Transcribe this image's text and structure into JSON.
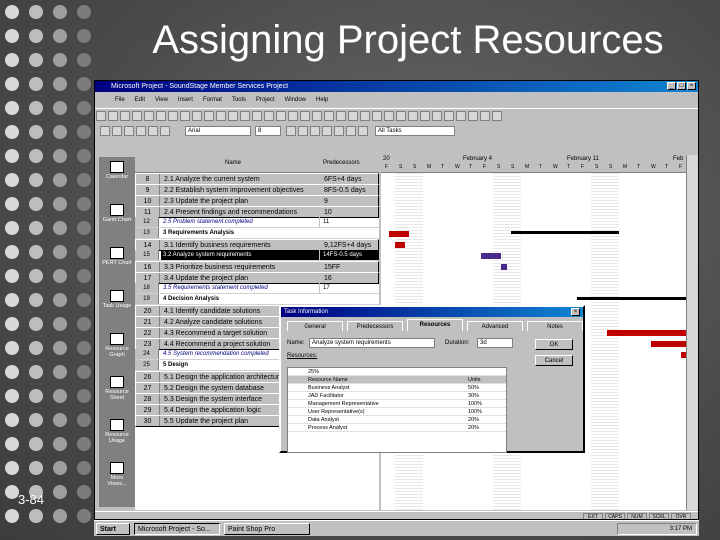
{
  "slide": {
    "title": "Assigning Project Resources",
    "page_number": "3-84"
  },
  "app": {
    "window_title": "Microsoft Project - SoundStage Member Services Project",
    "menu": [
      "File",
      "Edit",
      "View",
      "Insert",
      "Format",
      "Tools",
      "Project",
      "Window",
      "Help"
    ],
    "font_name": "Arial",
    "font_size": "8",
    "filter": "All Tasks"
  },
  "views": [
    "Calendar",
    "Gantt Chart",
    "PERT Chart",
    "Task Usage",
    "Resource Graph",
    "Resource Sheet",
    "Resource Usage",
    "More Views..."
  ],
  "table": {
    "col_name": "Name",
    "col_pred": "Predecessors",
    "rows": [
      {
        "id": "8",
        "name": "2.1 Analyze the current system",
        "pred": "6FS+4 days",
        "kind": "task"
      },
      {
        "id": "9",
        "name": "2.2 Establish system improvement objectives",
        "pred": "8FS-0.5 days",
        "kind": "task"
      },
      {
        "id": "10",
        "name": "2.3 Update the project plan",
        "pred": "9",
        "kind": "task"
      },
      {
        "id": "11",
        "name": "2.4 Present findings and recommendations",
        "pred": "10",
        "kind": "task"
      },
      {
        "id": "12",
        "name": "2.5 Problem statement completed",
        "pred": "11",
        "kind": "mile"
      },
      {
        "id": "13",
        "name": "3 Requirements Analysis",
        "pred": "",
        "kind": "sum"
      },
      {
        "id": "14",
        "name": "3.1 Identify business requirements",
        "pred": "9,12FS+4 days",
        "kind": "task"
      },
      {
        "id": "15",
        "name": "3.2 Analyze system requirements",
        "pred": "14FS-0.5 days",
        "kind": "sel"
      },
      {
        "id": "16",
        "name": "3.3 Prioritize business requirements",
        "pred": "15FF",
        "kind": "task"
      },
      {
        "id": "17",
        "name": "3.4 Update the project plan",
        "pred": "16",
        "kind": "task"
      },
      {
        "id": "18",
        "name": "3.5 Requirements statement completed",
        "pred": "17",
        "kind": "mile"
      },
      {
        "id": "19",
        "name": "4 Decision Analysis",
        "pred": "",
        "kind": "sum"
      },
      {
        "id": "20",
        "name": "4.1 Identify candidate solutions",
        "pred": "",
        "kind": "task"
      },
      {
        "id": "21",
        "name": "4.2 Analyze candidate solutions",
        "pred": "",
        "kind": "task"
      },
      {
        "id": "22",
        "name": "4.3 Recommend a target solution",
        "pred": "",
        "kind": "task"
      },
      {
        "id": "23",
        "name": "4.4 Recommend a project solution",
        "pred": "",
        "kind": "task"
      },
      {
        "id": "24",
        "name": "4.5 System recommendation completed",
        "pred": "",
        "kind": "mile"
      },
      {
        "id": "25",
        "name": "5 Design",
        "pred": "",
        "kind": "sum"
      },
      {
        "id": "26",
        "name": "5.1 Design the application architecture",
        "pred": "",
        "kind": "task"
      },
      {
        "id": "27",
        "name": "5.2 Design the system database",
        "pred": "",
        "kind": "task"
      },
      {
        "id": "28",
        "name": "5.3 Design the system interface",
        "pred": "",
        "kind": "task"
      },
      {
        "id": "29",
        "name": "5.4 Design the application logic",
        "pred": "",
        "kind": "task"
      },
      {
        "id": "30",
        "name": "5.5 Update the project plan",
        "pred": "",
        "kind": "task"
      }
    ]
  },
  "gantt": {
    "weeks": [
      "20",
      "February 4",
      "February 11",
      "Feb"
    ],
    "days": [
      "F",
      "S",
      "S",
      "M",
      "T",
      "W",
      "T",
      "F",
      "S",
      "S",
      "M",
      "T",
      "W",
      "T",
      "F",
      "S",
      "S",
      "M",
      "T",
      "W",
      "T",
      "F"
    ]
  },
  "dialog": {
    "title": "Task Information",
    "tabs": [
      "General",
      "Predecessors",
      "Resources",
      "Advanced",
      "Notes"
    ],
    "active_tab": "Resources",
    "name_label": "Name:",
    "name_value": "Analyze system requirements",
    "duration_label": "Duration:",
    "duration_value": "3d",
    "ok_label": "OK",
    "cancel_label": "Cancel",
    "resources_label": "Resources:",
    "edit_value": "25%",
    "col_resource": "Resource Name",
    "col_units": "Units",
    "resources": [
      {
        "name": "Business Analyst",
        "units": "50%"
      },
      {
        "name": "JAD Facilitator",
        "units": "30%"
      },
      {
        "name": "Management Representative",
        "units": "100%"
      },
      {
        "name": "User Representative(s)",
        "units": "100%"
      },
      {
        "name": "Data Analyst",
        "units": "20%"
      },
      {
        "name": "Process Analyst",
        "units": "20%"
      }
    ]
  },
  "statusbar": [
    "EXT",
    "CAPS",
    "NUM",
    "SCRL",
    "OVR"
  ],
  "taskbar": {
    "start": "Start",
    "tasks": [
      "Microsoft Project - So...",
      "Paint Shop Pro"
    ],
    "clock": "3:17 PM"
  }
}
